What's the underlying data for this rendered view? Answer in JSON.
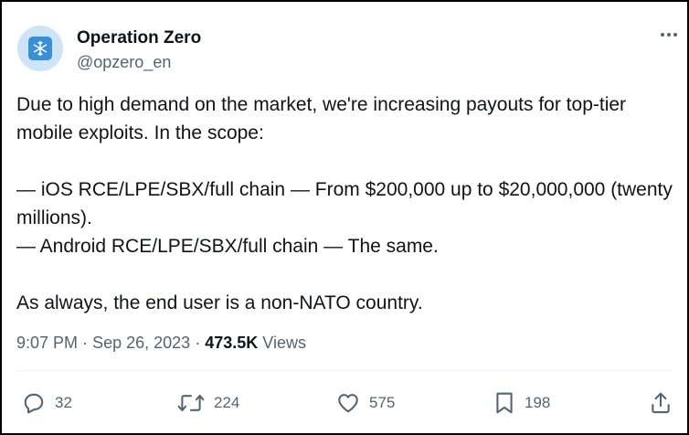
{
  "author": {
    "display_name": "Operation Zero",
    "handle": "@opzero_en",
    "avatar_icon": "snowflake-logo-icon"
  },
  "tweet": {
    "lines": [
      "Due to high demand on the market, we're increasing payouts for top-tier mobile exploits. In the scope:",
      "— iOS RCE/LPE/SBX/full chain — From $200,000 up to $20,000,000 (twenty millions).",
      "— Android RCE/LPE/SBX/full chain — The same.",
      "As always, the end user is a non-NATO country."
    ]
  },
  "meta": {
    "time": "9:07 PM",
    "separator": "·",
    "date": "Sep 26, 2023",
    "views_count": "473.5K",
    "views_label": "Views"
  },
  "actions": {
    "replies": "32",
    "reposts": "224",
    "likes": "575",
    "bookmarks": "198"
  },
  "colors": {
    "text": "#0f1419",
    "secondary": "#536471",
    "avatar_bg": "#cfe4f6",
    "avatar_fg": "#3a8fd6"
  }
}
